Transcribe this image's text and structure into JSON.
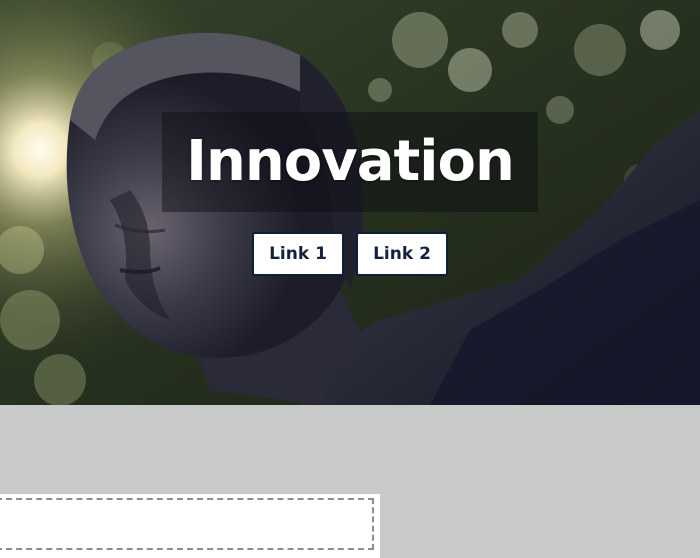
{
  "hero": {
    "title": "Innovation",
    "image_alt": "bronze statue with sunlight through trees"
  },
  "links": [
    {
      "label": "Link 1"
    },
    {
      "label": "Link 2"
    }
  ],
  "colors": {
    "lower_background": "#c8caca",
    "button_border": "#0e1f3a",
    "button_text": "#14233d",
    "title_text": "#ffffff"
  }
}
